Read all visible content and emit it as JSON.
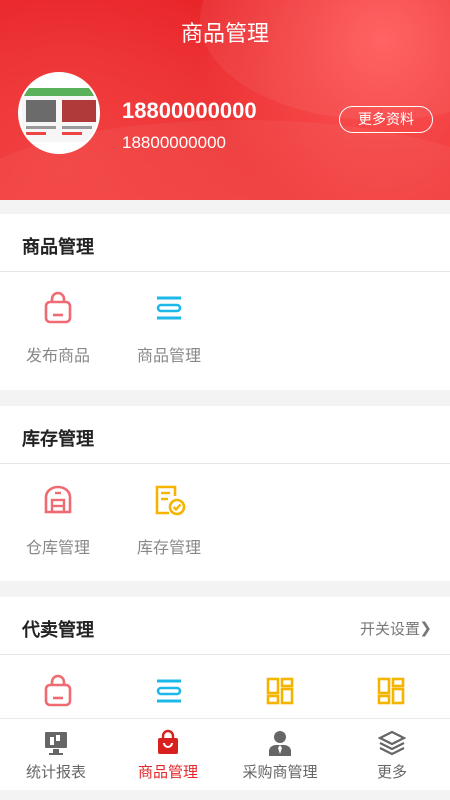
{
  "header": {
    "title": "商品管理",
    "name": "18800000000",
    "phone": "18800000000",
    "more_label": "更多资料"
  },
  "sections": {
    "goods": {
      "title": "商品管理",
      "items": [
        {
          "label": "发布商品",
          "icon": "bag-icon"
        },
        {
          "label": "商品管理",
          "icon": "list-icon"
        }
      ]
    },
    "stock": {
      "title": "库存管理",
      "items": [
        {
          "label": "仓库管理",
          "icon": "warehouse-icon"
        },
        {
          "label": "库存管理",
          "icon": "checklist-icon"
        }
      ]
    },
    "consign": {
      "title": "代卖管理",
      "action": "开关设置",
      "items": [
        {
          "icon": "bag-icon"
        },
        {
          "icon": "list-icon"
        },
        {
          "icon": "grid-icon"
        },
        {
          "icon": "grid-icon"
        }
      ]
    }
  },
  "tabbar": [
    {
      "label": "统计报表",
      "icon": "monitor-icon",
      "active": false
    },
    {
      "label": "商品管理",
      "icon": "shopping-bag-icon",
      "active": true
    },
    {
      "label": "采购商管理",
      "icon": "person-icon",
      "active": false
    },
    {
      "label": "更多",
      "icon": "layers-icon",
      "active": false
    }
  ],
  "colors": {
    "brand_red": "#e8262a",
    "icon_pink": "#ef6a72",
    "icon_blue": "#1cb8e8",
    "icon_yellow": "#f5b400"
  }
}
